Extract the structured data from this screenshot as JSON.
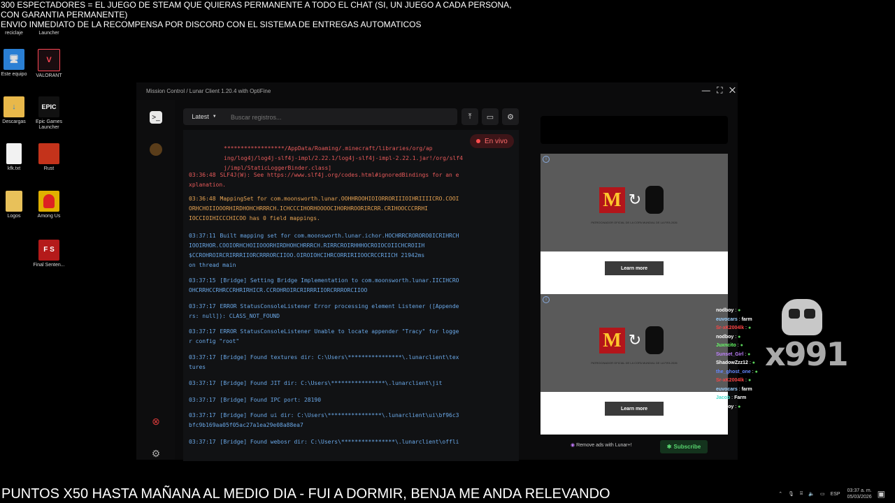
{
  "overlay_top": {
    "line1": "300 ESPECTADORES = EL JUEGO DE STEAM QUE QUIERAS PERMANENTE A TODO EL CHAT (SI, UN JUEGO A CADA PERSONA,",
    "line2": "CON GARANTIA PERMANENTE)",
    "line3": "ENVIO INMEDIATO DE LA RECOMPENSA POR DISCORD CON EL SISTEMA DE ENTREGAS AUTOMATICOS"
  },
  "desktop_icons": [
    {
      "label": "reciclaje",
      "icon": "recycle-bin-icon"
    },
    {
      "label": "Launcher",
      "icon": "launcher-icon"
    },
    {
      "label": "Este equipo",
      "icon": "computer-icon"
    },
    {
      "label": "VALORANT",
      "icon": "valorant-icon"
    },
    {
      "label": "Descargas",
      "icon": "downloads-folder-icon"
    },
    {
      "label": "Epic Games Launcher",
      "icon": "epic-games-icon",
      "glyph": "EPIC"
    },
    {
      "label": "kfk.txt",
      "icon": "text-file-icon"
    },
    {
      "label": "Rust",
      "icon": "rust-icon"
    },
    {
      "label": "Logos",
      "icon": "folder-icon"
    },
    {
      "label": "Among Us",
      "icon": "among-us-icon"
    },
    {
      "label": "Final Senten...",
      "icon": "final-sentence-icon",
      "glyph": "F S"
    }
  ],
  "window": {
    "title": "Mission Control / Lunar Client 1.20.4 with OptiFine",
    "controls": "— ⛶ ✕"
  },
  "toolbar": {
    "latest_label": "Latest",
    "search_placeholder": "Buscar registros..."
  },
  "live_badge": "En vivo",
  "log_lines": [
    {
      "time": "",
      "text": "******************/AppData/Roaming/.minecraft/libraries/org/ap\ning/log4j/log4j-slf4j-impl/2.22.1/log4j-slf4j-impl-2.22.1.jar!/org/slf4\nj/impl/StaticLoggerBinder.class]",
      "color": "#e85a5a"
    },
    {
      "time": "03:36:48",
      "text": "SLF4J(W): See https://www.slf4j.org/codes.html#ignoredBindings for an e\nxplanation.",
      "color": "#e85a5a"
    },
    {
      "time": "03:36:48",
      "text": "MappingSet for com.moonsworth.lunar.OOHHROOHIOIORRORIIIOIHRIIIICRO.COOI\nORHCHOIIOOORHIRDHOHCHRRRCH.ICHCCCIHORHOOOOCIHORHROORIRCRR.CRIHOOCCCRRHI\nIOCCIOIHICCCHICOO has 0 field mappings.",
      "color": "#e8a452"
    },
    {
      "time": "03:37:11",
      "text": "Built mapping set for com.moonsworth.lunar.ichor.HOCHRRCRORORO0ICRIHRCH\nIOOIRHOR.COOIORHCHOIIOOORHIRDHOHCHRRRCH.RIRRCROIRHHHOCROIOCOIICHCROIIH\n$CCROHROIRCRIRRRIIORCRRRORCIIOO.OIROIOHCIHRCORRIRIIOOCRCCRIICH 21942ms\non thread main",
      "color": "#6aa8e8"
    },
    {
      "time": "03:37:15",
      "text": "[Bridge] Setting Bridge Implementation to com.moonsworth.lunar.IICIHCRO\nOHCRRHCCRHRCCRHRIRHICR.CCROHROIRCRIRRRIIORCRRRORCIIOO",
      "color": "#6aa8e8"
    },
    {
      "time": "03:37:17",
      "text": "ERROR StatusConsoleListener Error processing element Listener ([Appende\nrs: null]): CLASS_NOT_FOUND",
      "color": "#6aa8e8"
    },
    {
      "time": "03:37:17",
      "text": "ERROR StatusConsoleListener Unable to locate appender \"Tracy\" for logge\nr config \"root\"",
      "color": "#6aa8e8"
    },
    {
      "time": "03:37:17",
      "text": "[Bridge] Found textures dir: C:\\Users\\****************\\.lunarclient\\tex\ntures",
      "color": "#6aa8e8"
    },
    {
      "time": "03:37:17",
      "text": "[Bridge] Found JIT dir: C:\\Users\\****************\\.lunarclient\\jit",
      "color": "#6aa8e8"
    },
    {
      "time": "03:37:17",
      "text": "[Bridge] Found IPC port: 28190",
      "color": "#6aa8e8"
    },
    {
      "time": "03:37:17",
      "text": "[Bridge] Found ui dir: C:\\Users\\****************\\.lunarclient\\ui\\bf96c3\nbfc9b169aa05f05ac27a1ea29e08a88ea7",
      "color": "#6aa8e8"
    },
    {
      "time": "03:37:17",
      "text": "[Bridge] Found webosr dir: C:\\Users\\****************\\.lunarclient\\offli",
      "color": "#6aa8e8"
    }
  ],
  "ads": [
    {
      "caption": "PATROCINADOR OFICIAL DE LA COPA MUNDIAL DE LA FIFA 2026",
      "button": "Learn more"
    },
    {
      "caption": "PATROCINADOR OFICIAL DE LA COPA MUNDIAL DE LA FIFA 2026",
      "button": "Learn more"
    }
  ],
  "remove_ads": "Remove ads with Lunar+!",
  "subscribe_label": "Subscribe",
  "chat": [
    {
      "user": "nodboy",
      "msg": "",
      "color": "#ffffff"
    },
    {
      "user": "euvocars",
      "msg": "farm",
      "color": "#9ad0ff"
    },
    {
      "user": "Sr-xK2004lk",
      "msg": "",
      "color": "#ff4444"
    },
    {
      "user": "nodboy",
      "msg": "",
      "color": "#ffffff"
    },
    {
      "user": "Juxncito",
      "msg": "",
      "color": "#66ff66"
    },
    {
      "user": "Sunset_Girl",
      "msg": "",
      "color": "#c080ff"
    },
    {
      "user": "ShadowZzz12",
      "msg": "",
      "color": "#ffffff"
    },
    {
      "user": "the_ghost_one",
      "msg": "",
      "color": "#6688ff"
    },
    {
      "user": "Sr-xK2004lk",
      "msg": "",
      "color": "#ff4444"
    },
    {
      "user": "euvocars",
      "msg": "farm",
      "color": "#9ad0ff"
    },
    {
      "user": "Jacob",
      "msg": "Farm",
      "color": "#44ddcc"
    },
    {
      "user": "nodboy",
      "msg": "",
      "color": "#ffffff"
    }
  ],
  "watermark": "x991",
  "bottom_banner": "PUNTOS X50 HASTA MAÑANA AL MEDIO DIA - FUI A DORMIR, BENJA ME ANDA RELEVANDO",
  "tray": {
    "lang": "ESP",
    "time": "03:37 a. m.",
    "date": "05/03/2026"
  }
}
